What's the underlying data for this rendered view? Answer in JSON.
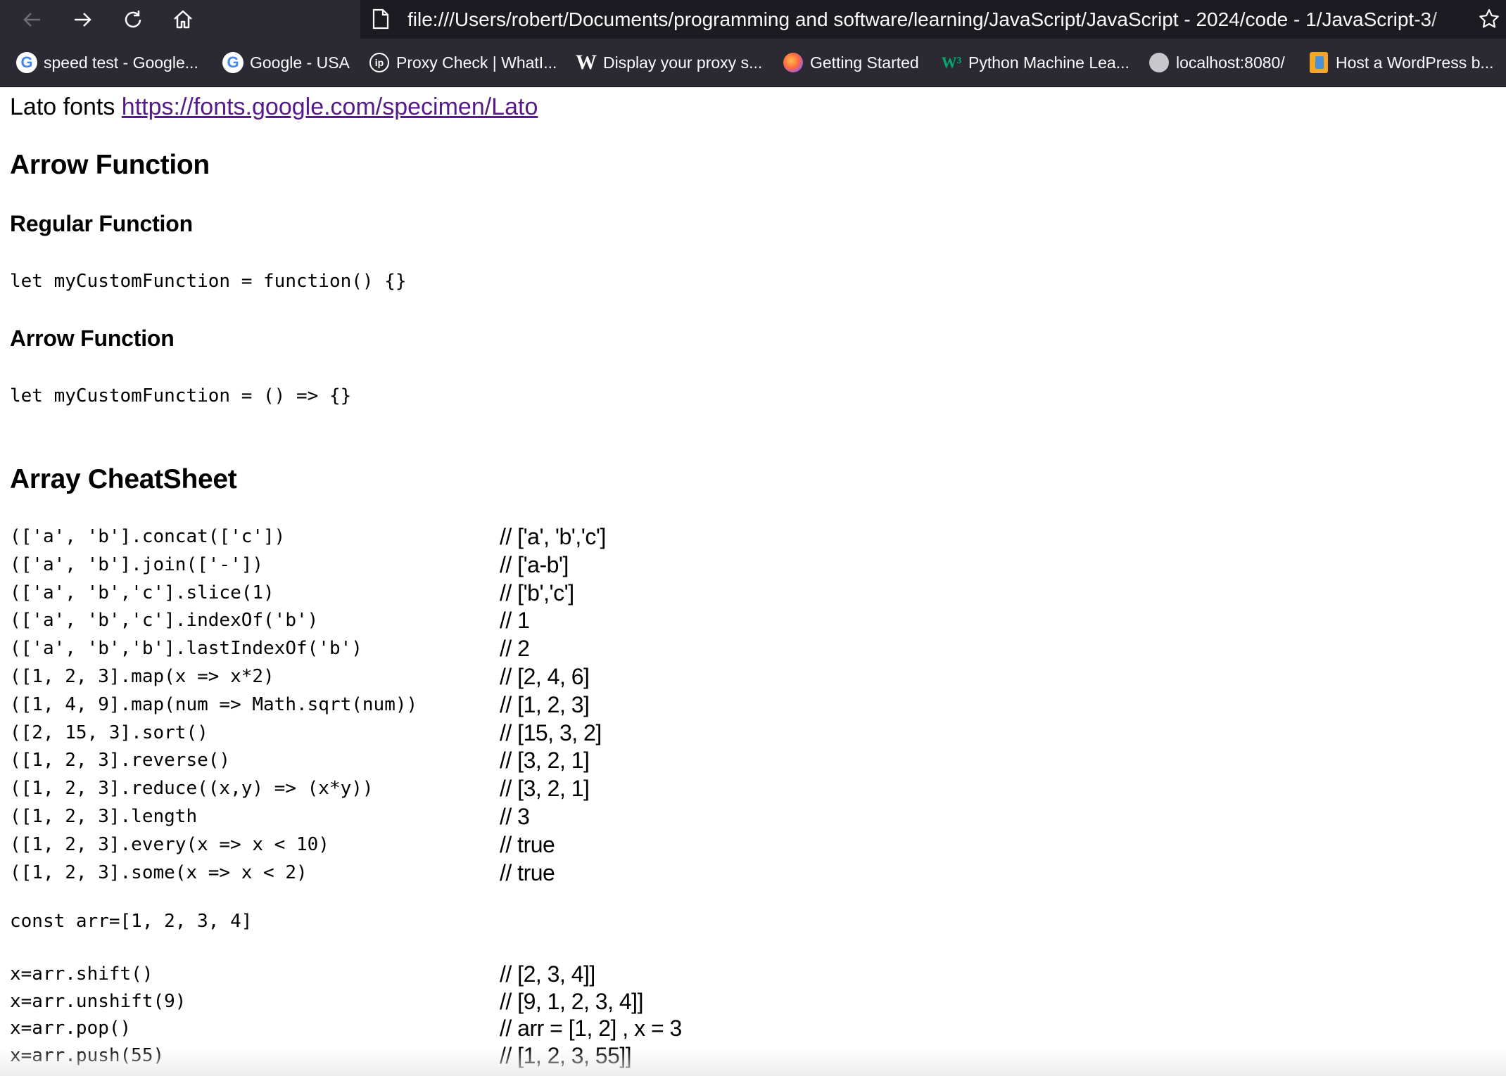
{
  "browser": {
    "url": "file:///Users/robert/Documents/programming and software/learning/JavaScript/JavaScript - 2024/code - 1/JavaScript-3/",
    "bookmarks": [
      {
        "label": "speed test - Google...",
        "icon": "google-icon"
      },
      {
        "label": "Google - USA",
        "icon": "google-icon"
      },
      {
        "label": "Proxy Check | WhatI...",
        "icon": "ip-icon"
      },
      {
        "label": "Display your proxy s...",
        "icon": "w-icon"
      },
      {
        "label": "Getting Started",
        "icon": "firefox-icon"
      },
      {
        "label": "Python Machine Lea...",
        "icon": "w3schools-icon"
      },
      {
        "label": "localhost:8080/",
        "icon": "database-icon"
      },
      {
        "label": "Host a WordPress b...",
        "icon": "box-icon"
      }
    ]
  },
  "page": {
    "lato_prefix": "Lato fonts",
    "lato_link": "https://fonts.google.com/specimen/Lato",
    "arrow_heading": "Arrow Function",
    "regular_subheading": "Regular Function",
    "regular_code": "let myCustomFunction = function() {}",
    "arrow_subheading": "Arrow Function",
    "arrow_code": "let myCustomFunction = () => {}",
    "array_heading": "Array CheatSheet",
    "array_rows": [
      {
        "code": "(['a', 'b'].concat(['c'])",
        "result": "// ['a', 'b','c']"
      },
      {
        "code": "(['a', 'b'].join(['-'])",
        "result": "// ['a-b']"
      },
      {
        "code": "(['a', 'b','c'].slice(1)",
        "result": "// ['b','c']"
      },
      {
        "code": "(['a', 'b','c'].indexOf('b')",
        "result": "// 1"
      },
      {
        "code": "(['a', 'b','b'].lastIndexOf('b')",
        "result": "// 2"
      },
      {
        "code": "([1, 2, 3].map(x => x*2)",
        "result": "// [2, 4, 6]"
      },
      {
        "code": "([1, 4, 9].map(num => Math.sqrt(num))",
        "result": "// [1, 2, 3]"
      },
      {
        "code": "([2, 15, 3].sort()",
        "result": "// [15, 3, 2]"
      },
      {
        "code": "([1, 2, 3].reverse()",
        "result": "// [3, 2, 1]"
      },
      {
        "code": "([1, 2, 3].reduce((x,y) => (x*y))",
        "result": "// [3, 2, 1]"
      },
      {
        "code": "([1, 2, 3].length",
        "result": "// 3"
      },
      {
        "code": "([1, 2, 3].every(x => x < 10)",
        "result": "// true"
      },
      {
        "code": "([1, 2, 3].some(x => x < 2)",
        "result": "// true"
      }
    ],
    "const_line": "const arr=[1, 2, 3, 4]",
    "mutation_rows": [
      {
        "code": "x=arr.shift()",
        "result": "// [2, 3, 4]]"
      },
      {
        "code": "x=arr.unshift(9)",
        "result": "// [9, 1, 2, 3, 4]]"
      },
      {
        "code": "x=arr.pop()",
        "result": "// arr = [1, 2] , x = 3"
      },
      {
        "code": "x=arr.push(55)",
        "result": "// [1, 2, 3, 55]]"
      }
    ]
  }
}
